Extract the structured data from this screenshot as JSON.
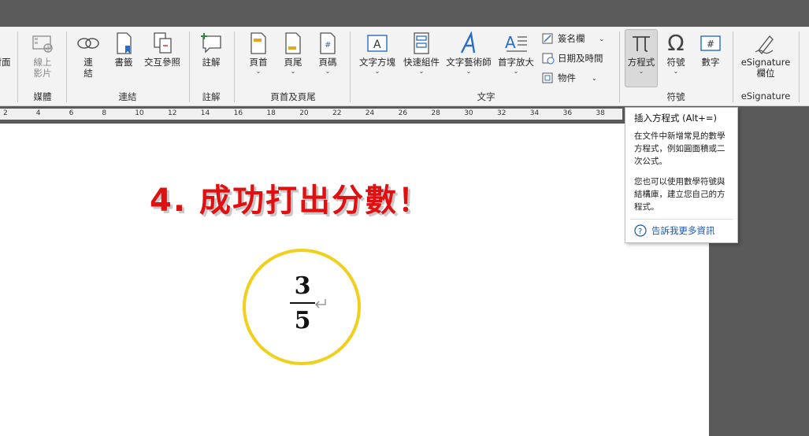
{
  "ribbon": {
    "buttons": {
      "cover": "封面",
      "online_video": "線上\n影片",
      "link": "連\n結",
      "bookmark": "書籤",
      "cross_ref": "交互參照",
      "comment": "註解",
      "header": "頁首",
      "footer": "頁尾",
      "page_number": "頁碼",
      "textbox": "文字方塊",
      "quickparts": "快速組件",
      "wordart": "文字藝術師",
      "dropcap": "首字放大",
      "signature_line": "簽名欄",
      "datetime": "日期及時間",
      "object": "物件",
      "equation": "方程式",
      "symbol": "符號",
      "number": "數字",
      "esig_field": "eSignature\n欄位"
    },
    "groups": {
      "media": "媒體",
      "links": "連結",
      "comments": "註解",
      "header_footer": "頁首及頁尾",
      "text": "文字",
      "symbols": "符號",
      "esignature": "eSignature"
    }
  },
  "ruler": {
    "ticks": [
      "2",
      "4",
      "6",
      "8",
      "10",
      "12",
      "14",
      "16",
      "18",
      "20",
      "22",
      "24",
      "26",
      "28",
      "30",
      "32",
      "34",
      "36",
      "38"
    ]
  },
  "document": {
    "heading": "4. 成功打出分數！",
    "fraction": {
      "numerator": "3",
      "denominator": "5"
    }
  },
  "tooltip": {
    "title": "插入方程式 (Alt+=)",
    "desc1": "在文件中新增常見的數學方程式，例如圓面積或二次公式。",
    "desc2": "您也可以使用數學符號與結構庫，建立您自己的方程式。",
    "link": "告訴我更多資訊"
  },
  "colors": {
    "heading": "#e01010",
    "circle": "#f2cf1c",
    "accent": "#1a56b0"
  }
}
